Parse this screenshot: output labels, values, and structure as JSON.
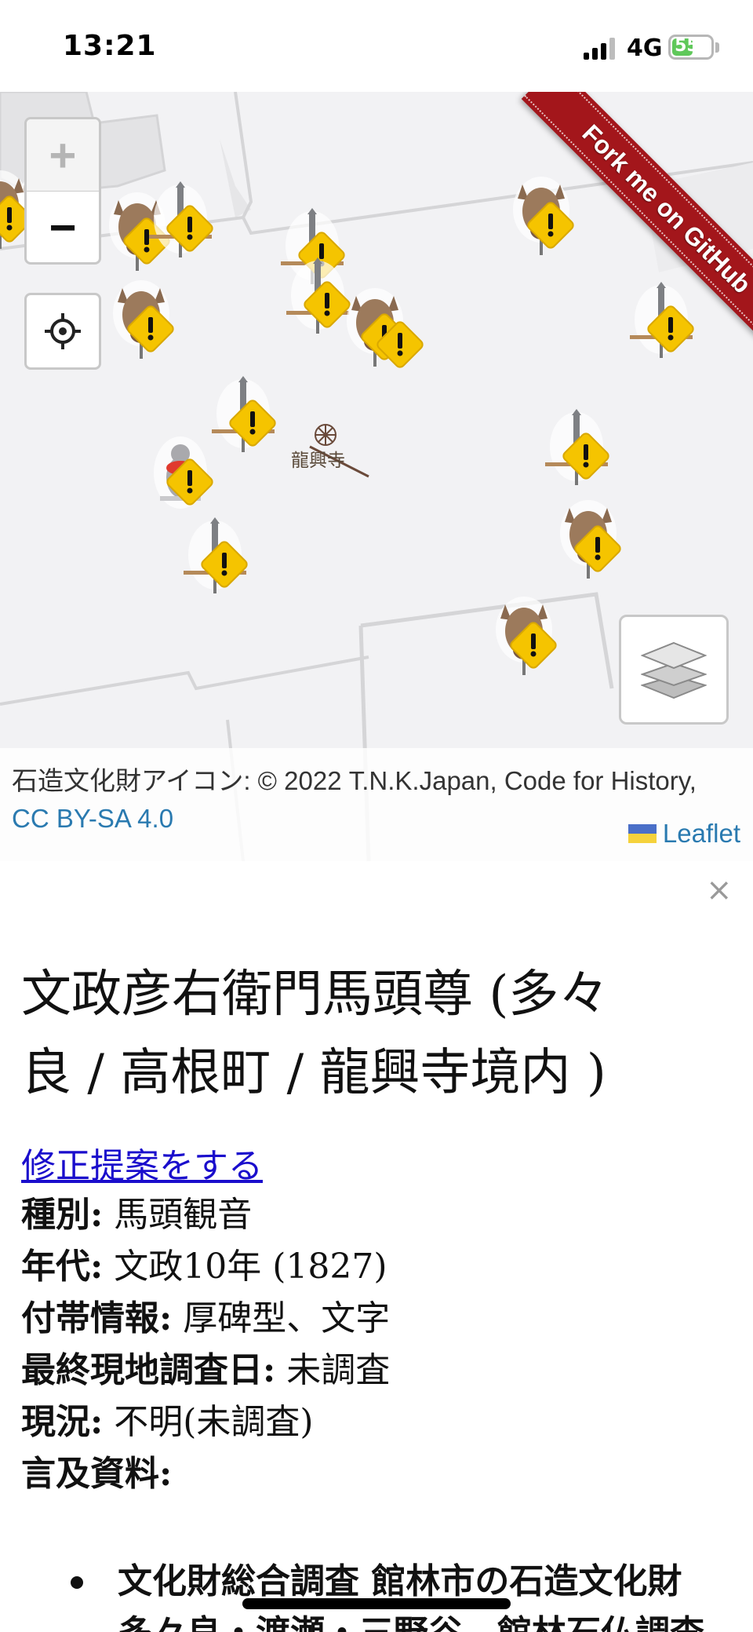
{
  "status_bar": {
    "time": "13:21",
    "network": "4G",
    "battery": "55",
    "battery_level": 0.55,
    "charging": true
  },
  "map": {
    "zoom_in_label": "+",
    "zoom_out_label": "−",
    "zoom_in_enabled": false,
    "locate_icon": "crosshair-icon",
    "layers_icon": "layers-icon",
    "ribbon_text": "Fork me on GitHub",
    "temple_label": "龍興寺",
    "marker_icons": [
      "horse-head-icon",
      "stone-monument-icon",
      "jizo-statue-icon",
      "warning-badge-icon"
    ],
    "colors": {
      "warning": "#f5c400",
      "ribbon": "#a3161b",
      "link": "#2a7ab0"
    }
  },
  "attribution": {
    "text": "石造文化財アイコン: © 2022 T.N.K.Japan, Code for History, ",
    "license": "CC BY-SA 4.0",
    "leaflet": "Leaflet"
  },
  "panel": {
    "close_label": "×",
    "title_line1": "文政彦右衛門馬頭尊 (多々",
    "title_line2": "良 / 高根町 / 龍興寺境内 )",
    "edit_link": "修正提案をする",
    "fields": [
      {
        "label": "種別:",
        "value": "馬頭観音"
      },
      {
        "label": "年代:",
        "value": "文政10年 (1827)"
      },
      {
        "label": "付帯情報:",
        "value": "厚碑型、文字"
      },
      {
        "label": "最終現地調査日:",
        "value": "未調査"
      },
      {
        "label": "現況:",
        "value": "不明(未調査)"
      },
      {
        "label": "言及資料:",
        "value": ""
      }
    ],
    "reference_line1": "文化財総合調査 館林市の石造文化財",
    "reference_line2": "多々良・渡瀬・三野谷　館林石仏調査"
  }
}
